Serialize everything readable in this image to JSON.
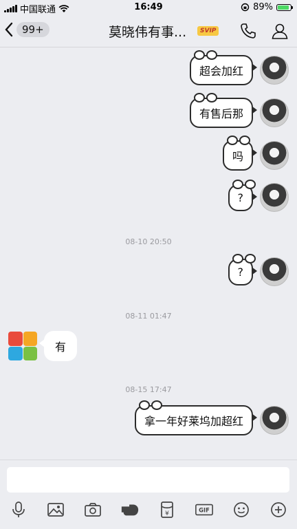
{
  "status": {
    "carrier": "中国联通",
    "time": "16:49",
    "battery": "89%",
    "battery_level": 0.89
  },
  "nav": {
    "back_badge": "99+",
    "title": "莫晓伟有事...",
    "badge": "SVIP"
  },
  "messages": [
    {
      "dir": "out",
      "text": "超会加红"
    },
    {
      "dir": "out",
      "text": "有售后那"
    },
    {
      "dir": "out",
      "text": "吗"
    },
    {
      "dir": "out",
      "text": "?"
    },
    {
      "timestamp": "08-10 20:50"
    },
    {
      "dir": "out",
      "text": "?"
    },
    {
      "timestamp": "08-11 01:47"
    },
    {
      "dir": "in",
      "text": "有"
    },
    {
      "timestamp": "08-15 17:47"
    },
    {
      "dir": "out",
      "text": "拿一年好莱坞加超红"
    }
  ],
  "input": {
    "placeholder": ""
  },
  "toolbar": [
    "mic-icon",
    "image-icon",
    "camera-icon",
    "hand-icon",
    "red-packet-icon",
    "gif-icon",
    "emoji-icon",
    "plus-icon"
  ],
  "colors": {
    "accent": "#f7c843",
    "battery": "#4cd964"
  }
}
